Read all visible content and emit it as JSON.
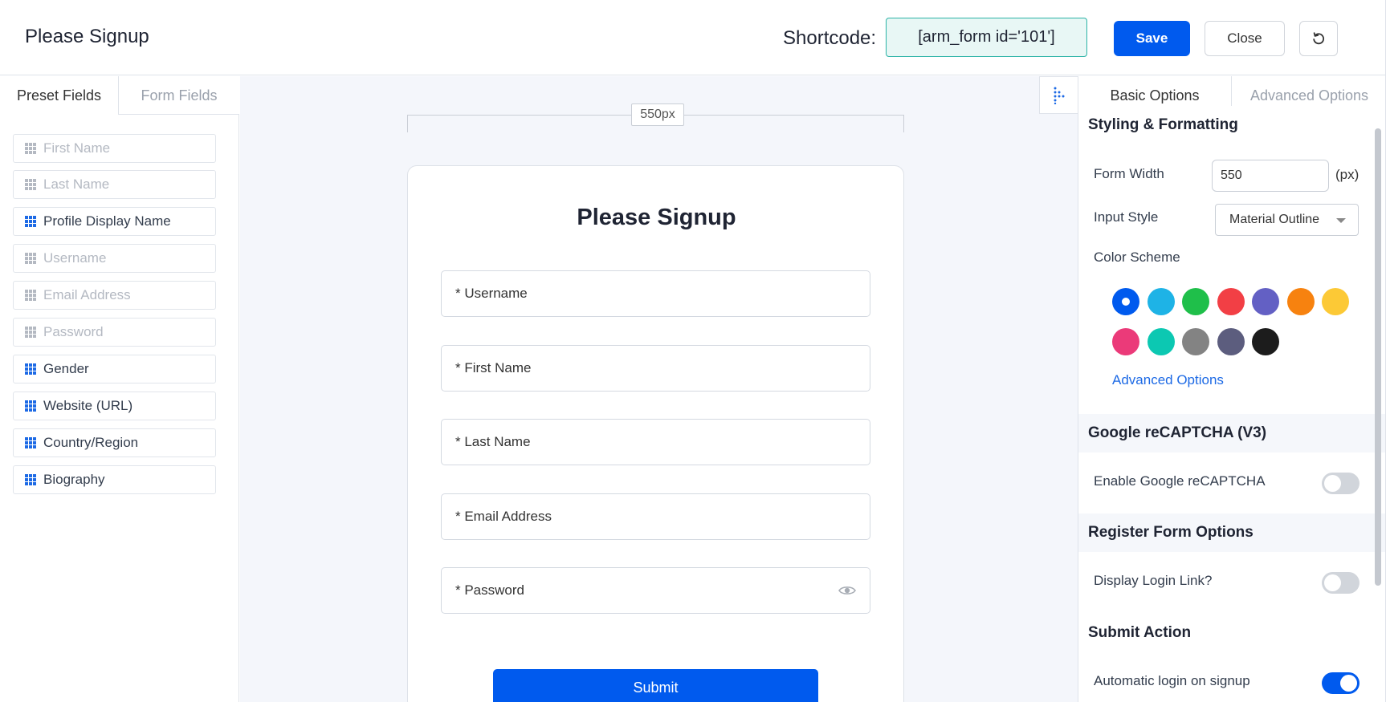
{
  "header": {
    "title": "Please Signup",
    "shortcode_label": "Shortcode:",
    "shortcode_value": "[arm_form id='101']",
    "save_label": "Save",
    "close_label": "Close"
  },
  "left_panel": {
    "tabs": [
      {
        "label": "Preset Fields",
        "active": true
      },
      {
        "label": "Form Fields",
        "active": false
      }
    ],
    "fields": [
      {
        "label": "First Name",
        "enabled": false
      },
      {
        "label": "Last Name",
        "enabled": false
      },
      {
        "label": "Profile Display Name",
        "enabled": true
      },
      {
        "label": "Username",
        "enabled": false
      },
      {
        "label": "Email Address",
        "enabled": false
      },
      {
        "label": "Password",
        "enabled": false
      },
      {
        "label": "Gender",
        "enabled": true
      },
      {
        "label": "Website (URL)",
        "enabled": true
      },
      {
        "label": "Country/Region",
        "enabled": true
      },
      {
        "label": "Biography",
        "enabled": true
      }
    ]
  },
  "canvas": {
    "width_label": "550px",
    "form": {
      "title": "Please Signup",
      "inputs": [
        {
          "label": "* Username"
        },
        {
          "label": "* First Name"
        },
        {
          "label": "* Last Name"
        },
        {
          "label": "* Email Address"
        },
        {
          "label": "* Password",
          "has_eye_icon": true
        }
      ],
      "submit_label": "Submit"
    }
  },
  "right_panel": {
    "tabs": [
      {
        "label": "Basic Options",
        "active": true
      },
      {
        "label": "Advanced Options",
        "active": false
      }
    ],
    "styling": {
      "heading": "Styling & Formatting",
      "form_width_label": "Form Width",
      "form_width_value": "550",
      "form_width_unit": "(px)",
      "input_style_label": "Input Style",
      "input_style_value": "Material Outline",
      "color_scheme_label": "Color Scheme",
      "colors": [
        "#005aee",
        "#1eb3e6",
        "#1fbf4a",
        "#f23f45",
        "#6360c4",
        "#f7820f",
        "#fcc936",
        "#eb3a79",
        "#0cc8b2",
        "#838383",
        "#5c5d7e",
        "#1c1c1c"
      ],
      "selected_color_index": 0,
      "advanced_link": "Advanced Options"
    },
    "recaptcha": {
      "heading": "Google reCAPTCHA (V3)",
      "enable_label": "Enable Google reCAPTCHA",
      "enabled": false
    },
    "register": {
      "heading": "Register Form Options",
      "login_link_label": "Display Login Link?",
      "enabled": false
    },
    "submit_action": {
      "heading": "Submit Action",
      "auto_login_label": "Automatic login on signup",
      "enabled": true
    }
  }
}
